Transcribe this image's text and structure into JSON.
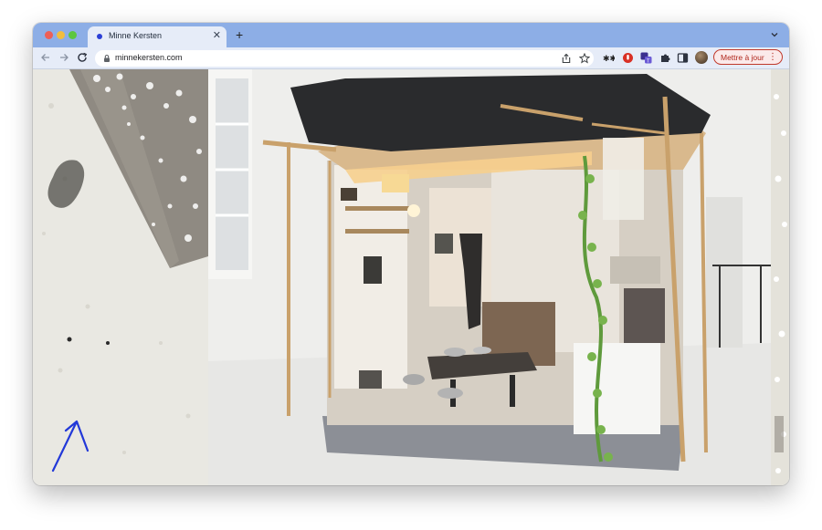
{
  "tab": {
    "title": "Minne Kersten"
  },
  "address_bar": {
    "url": "minnekersten.com"
  },
  "update_button": {
    "label": "Mettre à jour"
  },
  "icons": {
    "back": "arrow-left-icon",
    "forward": "arrow-right-icon",
    "reload": "reload-icon",
    "lock": "lock-icon",
    "share": "share-icon",
    "bookmark": "star-icon",
    "extensions": "puzzle-icon",
    "sidepanel": "side-panel-icon",
    "scroll_hint": "arrow-up-right-icon"
  },
  "colors": {
    "titlebar": "#8daee6",
    "toolbar": "#e6ecf8",
    "update_accent": "#c0392b",
    "arrow_ink": "#2238d8"
  }
}
